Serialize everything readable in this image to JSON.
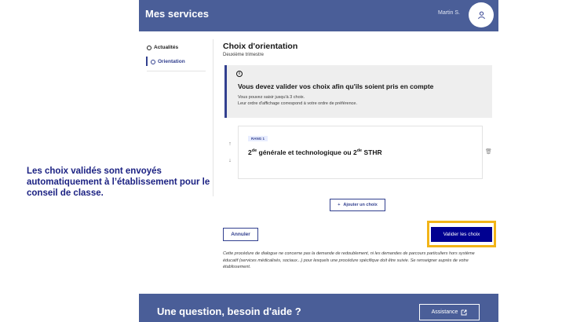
{
  "header": {
    "title": "Mes services",
    "user_name": "Martin S."
  },
  "sidebar": {
    "items": [
      {
        "label": "Actualités"
      },
      {
        "label": "Orientation"
      }
    ]
  },
  "main": {
    "title": "Choix d'orientation",
    "subtitle": "Deuxième trimestre",
    "notice": {
      "title": "Vous devez valider vos choix afin qu'ils soient pris en compte",
      "line1": "Vous pouvez saisir jusqu'à 3 choix.",
      "line2": "Leur ordre d'affichage correspond à votre ordre de préférence."
    },
    "choice": {
      "rank": "RANG 1",
      "part1": "2",
      "sup1": "de",
      "part2": " générale et technologique ou 2",
      "sup2": "de",
      "part3": " STHR"
    },
    "add_button": "Ajouter un choix",
    "cancel_button": "Annuler",
    "validate_button": "Valider les choix",
    "disclaimer": "Cette procédure de dialogue ne concerne pas la demande de redoublement, ni les demandes de parcours particuliers hors système éducatif (services médicalisés, sociaux...) pour lesquels une procédure spécifique doit être suivie. Se renseigner auprès de votre établissement."
  },
  "callout": {
    "line1": "Les choix validés sont envoyés",
    "line2": "automatiquement à l’établissement pour le",
    "line3": "conseil de classe."
  },
  "footer": {
    "title": "Une question, besoin d'aide ?",
    "assist_button": "Assistance"
  },
  "icons": {
    "avatar": "user-icon",
    "info": "info-icon",
    "up": "arrow-up-icon",
    "down": "arrow-down-icon",
    "trash": "trash-icon",
    "add": "plus-icon",
    "assist": "external-link-icon"
  },
  "colors": {
    "header": "#4a5e98",
    "primary": "#000091",
    "highlight": "#f2b418",
    "callout_text": "#1c2283"
  }
}
